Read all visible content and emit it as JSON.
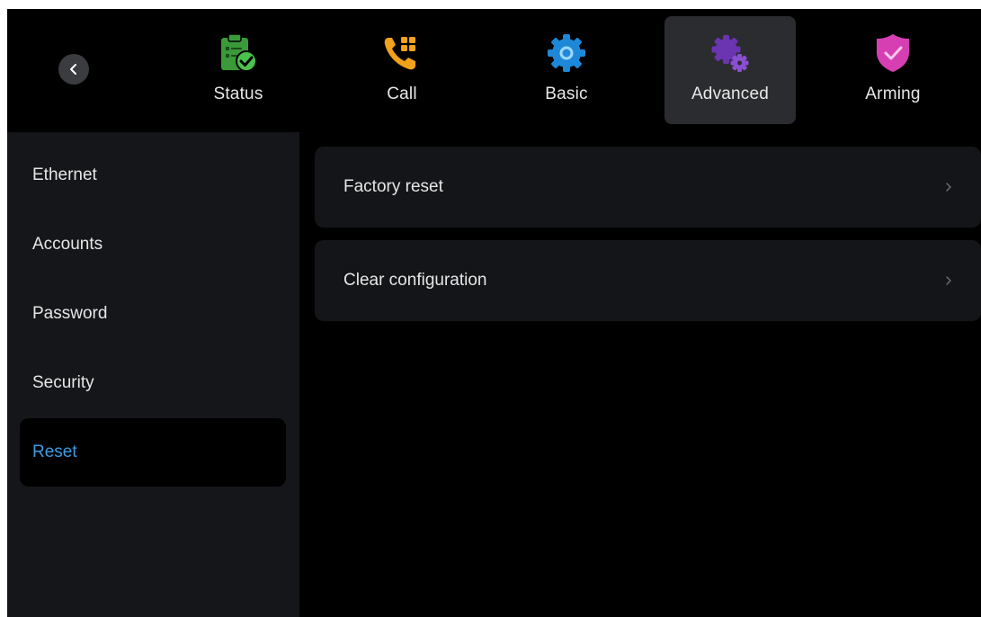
{
  "topbar": {
    "back_icon": "chevron-left-icon",
    "tabs": [
      {
        "label": "Status",
        "icon": "clipboard-check-icon",
        "color": "#3daa3d",
        "active": false
      },
      {
        "label": "Call",
        "icon": "phone-grid-icon",
        "color": "#f0a21a",
        "active": false
      },
      {
        "label": "Basic",
        "icon": "gear-icon",
        "color": "#1e88d8",
        "active": false
      },
      {
        "label": "Advanced",
        "icon": "gears-icon",
        "color": "#7a3fbf",
        "active": true
      },
      {
        "label": "Arming",
        "icon": "shield-check-icon",
        "color": "#d63fb2",
        "active": false
      }
    ]
  },
  "sidebar": {
    "items": [
      {
        "label": "Ethernet",
        "active": false
      },
      {
        "label": "Accounts",
        "active": false
      },
      {
        "label": "Password",
        "active": false
      },
      {
        "label": "Security",
        "active": false
      },
      {
        "label": "Reset",
        "active": true
      }
    ]
  },
  "content": {
    "rows": [
      {
        "label": "Factory reset",
        "icon": "chevron-right-icon"
      },
      {
        "label": "Clear configuration",
        "icon": "chevron-right-icon"
      }
    ]
  },
  "colors": {
    "background": "#000000",
    "sidebar": "#141619",
    "card": "#131518",
    "active_tab": "#2a2c30",
    "accent": "#3d9be0"
  }
}
